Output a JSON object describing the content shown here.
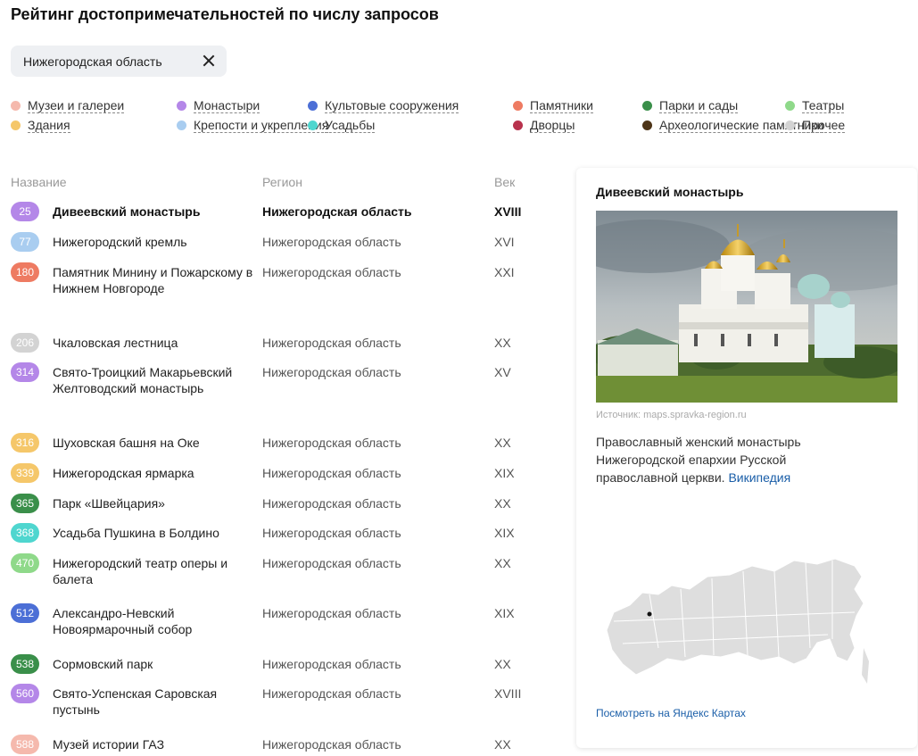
{
  "title": "Рейтинг достопримечательностей по числу запросов",
  "filter": {
    "value": "Нижегородская область"
  },
  "legend": [
    {
      "label": "Музеи и галереи",
      "color": "#f5b9ad"
    },
    {
      "label": "Монастыри",
      "color": "#b487e8"
    },
    {
      "label": "Культовые сооружения",
      "color": "#4c6fd6"
    },
    {
      "label": "Памятники",
      "color": "#ee7b62"
    },
    {
      "label": "Парки и сады",
      "color": "#3a8f4a"
    },
    {
      "label": "Театры",
      "color": "#8fd98a"
    },
    {
      "label": "Здания",
      "color": "#f5c76a"
    },
    {
      "label": "Крепости и укрепления",
      "color": "#a9cdf0"
    },
    {
      "label": "Усадьбы",
      "color": "#4fd6cf"
    },
    {
      "label": "Дворцы",
      "color": "#b8324d"
    },
    {
      "label": "Археологические памятники",
      "color": "#4d3417"
    },
    {
      "label": "Прочее",
      "color": "#d3d3d3"
    }
  ],
  "columns": {
    "name": "Название",
    "region": "Регион",
    "century": "Век"
  },
  "rows": [
    {
      "rank": "25",
      "name": "Дивеевский монастырь",
      "region": "Нижегородская область",
      "century": "XVIII",
      "color": "#b487e8"
    },
    {
      "rank": "77",
      "name": "Нижегородский кремль",
      "region": "Нижегородская область",
      "century": "XVI",
      "color": "#a9cdf0"
    },
    {
      "rank": "180",
      "name": "Памятник Минину и Пожарскому в Нижнем Новгороде",
      "region": "Нижегородская область",
      "century": "XXI",
      "color": "#ee7b62"
    },
    {
      "rank": "206",
      "name": "Чкаловская лестница",
      "region": "Нижегородская область",
      "century": "XX",
      "color": "#d3d3d3"
    },
    {
      "rank": "314",
      "name": "Свято-Троицкий Макарьевский Желтоводский монастырь",
      "region": "Нижегородская область",
      "century": "XV",
      "color": "#b487e8"
    },
    {
      "rank": "316",
      "name": "Шуховская башня на Оке",
      "region": "Нижегородская область",
      "century": "XX",
      "color": "#f5c76a"
    },
    {
      "rank": "339",
      "name": "Нижегородская ярмарка",
      "region": "Нижегородская область",
      "century": "XIX",
      "color": "#f5c76a"
    },
    {
      "rank": "365",
      "name": "Парк «Швейцария»",
      "region": "Нижегородская область",
      "century": "XX",
      "color": "#3a8f4a"
    },
    {
      "rank": "368",
      "name": "Усадьба Пушкина в Болдино",
      "region": "Нижегородская область",
      "century": "XIX",
      "color": "#4fd6cf"
    },
    {
      "rank": "470",
      "name": "Нижегородский театр оперы и балета",
      "region": "Нижегородская область",
      "century": "XX",
      "color": "#8fd98a"
    },
    {
      "rank": "512",
      "name": "Александро-Невский Новоярмарочный собор",
      "region": "Нижегородская область",
      "century": "XIX",
      "color": "#4c6fd6"
    },
    {
      "rank": "538",
      "name": "Сормовский парк",
      "region": "Нижегородская область",
      "century": "XX",
      "color": "#3a8f4a"
    },
    {
      "rank": "560",
      "name": "Свято-Успенская Саровская пустынь",
      "region": "Нижегородская область",
      "century": "XVIII",
      "color": "#b487e8"
    },
    {
      "rank": "588",
      "name": "Музей истории ГАЗ",
      "region": "Нижегородская область",
      "century": "XX",
      "color": "#f5b9ad"
    }
  ],
  "card": {
    "title": "Дивеевский монастырь",
    "source": "Источник: maps.spravka-region.ru",
    "description": "Православный женский монастырь Нижегородской епархии Русской православной церкви.",
    "wiki_link": "Википедия",
    "map_link": "Посмотреть на Яндекс Картах"
  }
}
